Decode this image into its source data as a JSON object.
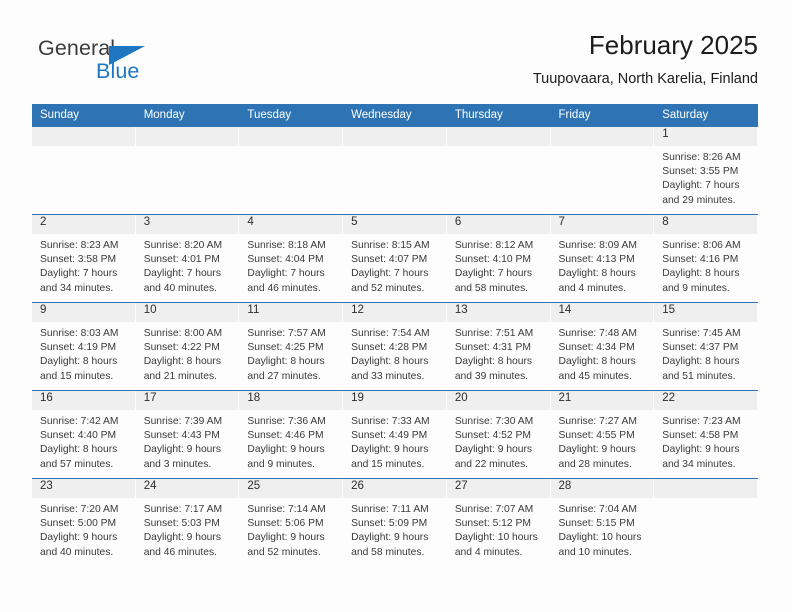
{
  "brand": {
    "name_part1": "General",
    "name_part2": "Blue",
    "flag_icon": "triangle-flag-icon",
    "accent_color": "#1f77c2"
  },
  "header": {
    "title": "February 2025",
    "subtitle": "Tuupovaara, North Karelia, Finland"
  },
  "theme": {
    "header_blue": "#2e74b5",
    "day_band_gray": "#efefef",
    "page_background": "#fdfdfd",
    "text_color": "#3a3a3a"
  },
  "weekdays": [
    "Sunday",
    "Monday",
    "Tuesday",
    "Wednesday",
    "Thursday",
    "Friday",
    "Saturday"
  ],
  "labels": {
    "sunrise_prefix": "Sunrise: ",
    "sunset_prefix": "Sunset: ",
    "daylight_prefix": "Daylight: "
  },
  "weeks": [
    [
      {
        "day": "",
        "empty": true
      },
      {
        "day": "",
        "empty": true
      },
      {
        "day": "",
        "empty": true
      },
      {
        "day": "",
        "empty": true
      },
      {
        "day": "",
        "empty": true
      },
      {
        "day": "",
        "empty": true
      },
      {
        "day": "1",
        "sunrise": "Sunrise: 8:26 AM",
        "sunset": "Sunset: 3:55 PM",
        "daylight": "Daylight: 7 hours and 29 minutes."
      }
    ],
    [
      {
        "day": "2",
        "sunrise": "Sunrise: 8:23 AM",
        "sunset": "Sunset: 3:58 PM",
        "daylight": "Daylight: 7 hours and 34 minutes."
      },
      {
        "day": "3",
        "sunrise": "Sunrise: 8:20 AM",
        "sunset": "Sunset: 4:01 PM",
        "daylight": "Daylight: 7 hours and 40 minutes."
      },
      {
        "day": "4",
        "sunrise": "Sunrise: 8:18 AM",
        "sunset": "Sunset: 4:04 PM",
        "daylight": "Daylight: 7 hours and 46 minutes."
      },
      {
        "day": "5",
        "sunrise": "Sunrise: 8:15 AM",
        "sunset": "Sunset: 4:07 PM",
        "daylight": "Daylight: 7 hours and 52 minutes."
      },
      {
        "day": "6",
        "sunrise": "Sunrise: 8:12 AM",
        "sunset": "Sunset: 4:10 PM",
        "daylight": "Daylight: 7 hours and 58 minutes."
      },
      {
        "day": "7",
        "sunrise": "Sunrise: 8:09 AM",
        "sunset": "Sunset: 4:13 PM",
        "daylight": "Daylight: 8 hours and 4 minutes."
      },
      {
        "day": "8",
        "sunrise": "Sunrise: 8:06 AM",
        "sunset": "Sunset: 4:16 PM",
        "daylight": "Daylight: 8 hours and 9 minutes."
      }
    ],
    [
      {
        "day": "9",
        "sunrise": "Sunrise: 8:03 AM",
        "sunset": "Sunset: 4:19 PM",
        "daylight": "Daylight: 8 hours and 15 minutes."
      },
      {
        "day": "10",
        "sunrise": "Sunrise: 8:00 AM",
        "sunset": "Sunset: 4:22 PM",
        "daylight": "Daylight: 8 hours and 21 minutes."
      },
      {
        "day": "11",
        "sunrise": "Sunrise: 7:57 AM",
        "sunset": "Sunset: 4:25 PM",
        "daylight": "Daylight: 8 hours and 27 minutes."
      },
      {
        "day": "12",
        "sunrise": "Sunrise: 7:54 AM",
        "sunset": "Sunset: 4:28 PM",
        "daylight": "Daylight: 8 hours and 33 minutes."
      },
      {
        "day": "13",
        "sunrise": "Sunrise: 7:51 AM",
        "sunset": "Sunset: 4:31 PM",
        "daylight": "Daylight: 8 hours and 39 minutes."
      },
      {
        "day": "14",
        "sunrise": "Sunrise: 7:48 AM",
        "sunset": "Sunset: 4:34 PM",
        "daylight": "Daylight: 8 hours and 45 minutes."
      },
      {
        "day": "15",
        "sunrise": "Sunrise: 7:45 AM",
        "sunset": "Sunset: 4:37 PM",
        "daylight": "Daylight: 8 hours and 51 minutes."
      }
    ],
    [
      {
        "day": "16",
        "sunrise": "Sunrise: 7:42 AM",
        "sunset": "Sunset: 4:40 PM",
        "daylight": "Daylight: 8 hours and 57 minutes."
      },
      {
        "day": "17",
        "sunrise": "Sunrise: 7:39 AM",
        "sunset": "Sunset: 4:43 PM",
        "daylight": "Daylight: 9 hours and 3 minutes."
      },
      {
        "day": "18",
        "sunrise": "Sunrise: 7:36 AM",
        "sunset": "Sunset: 4:46 PM",
        "daylight": "Daylight: 9 hours and 9 minutes."
      },
      {
        "day": "19",
        "sunrise": "Sunrise: 7:33 AM",
        "sunset": "Sunset: 4:49 PM",
        "daylight": "Daylight: 9 hours and 15 minutes."
      },
      {
        "day": "20",
        "sunrise": "Sunrise: 7:30 AM",
        "sunset": "Sunset: 4:52 PM",
        "daylight": "Daylight: 9 hours and 22 minutes."
      },
      {
        "day": "21",
        "sunrise": "Sunrise: 7:27 AM",
        "sunset": "Sunset: 4:55 PM",
        "daylight": "Daylight: 9 hours and 28 minutes."
      },
      {
        "day": "22",
        "sunrise": "Sunrise: 7:23 AM",
        "sunset": "Sunset: 4:58 PM",
        "daylight": "Daylight: 9 hours and 34 minutes."
      }
    ],
    [
      {
        "day": "23",
        "sunrise": "Sunrise: 7:20 AM",
        "sunset": "Sunset: 5:00 PM",
        "daylight": "Daylight: 9 hours and 40 minutes."
      },
      {
        "day": "24",
        "sunrise": "Sunrise: 7:17 AM",
        "sunset": "Sunset: 5:03 PM",
        "daylight": "Daylight: 9 hours and 46 minutes."
      },
      {
        "day": "25",
        "sunrise": "Sunrise: 7:14 AM",
        "sunset": "Sunset: 5:06 PM",
        "daylight": "Daylight: 9 hours and 52 minutes."
      },
      {
        "day": "26",
        "sunrise": "Sunrise: 7:11 AM",
        "sunset": "Sunset: 5:09 PM",
        "daylight": "Daylight: 9 hours and 58 minutes."
      },
      {
        "day": "27",
        "sunrise": "Sunrise: 7:07 AM",
        "sunset": "Sunset: 5:12 PM",
        "daylight": "Daylight: 10 hours and 4 minutes."
      },
      {
        "day": "28",
        "sunrise": "Sunrise: 7:04 AM",
        "sunset": "Sunset: 5:15 PM",
        "daylight": "Daylight: 10 hours and 10 minutes."
      },
      {
        "day": "",
        "empty": true
      }
    ]
  ]
}
